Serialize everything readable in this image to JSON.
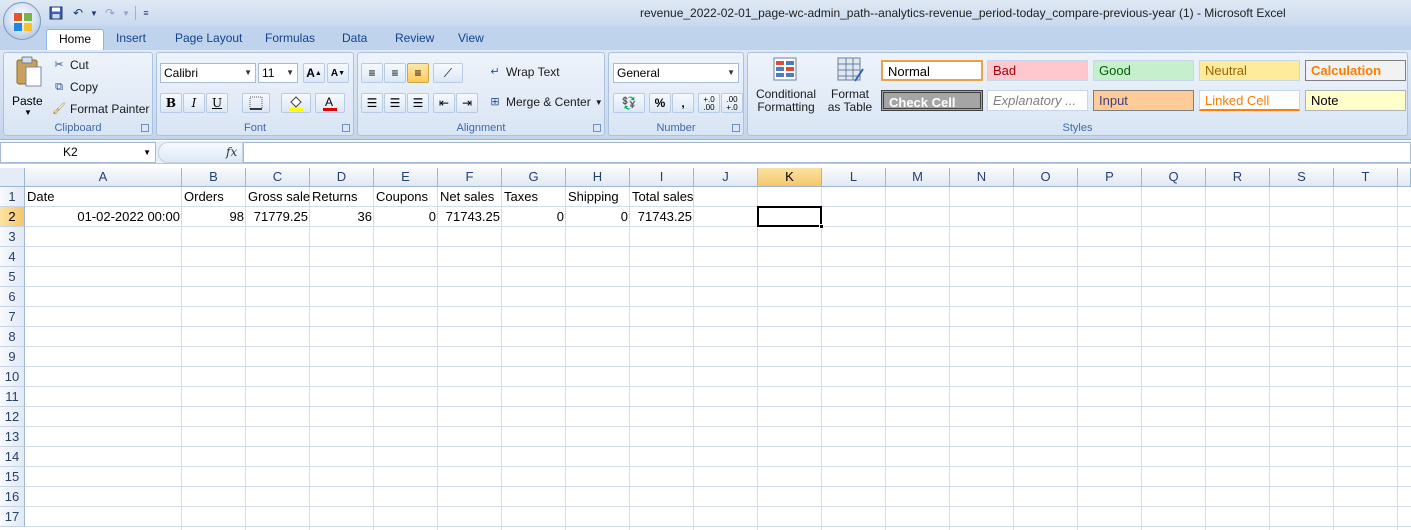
{
  "window": {
    "title": "revenue_2022-02-01_page-wc-admin_path--analytics-revenue_period-today_compare-previous-year (1) - Microsoft Excel"
  },
  "ribbon_tabs": [
    "Home",
    "Insert",
    "Page Layout",
    "Formulas",
    "Data",
    "Review",
    "View"
  ],
  "clipboard": {
    "paste": "Paste",
    "cut": "Cut",
    "copy": "Copy",
    "format_painter": "Format Painter",
    "label": "Clipboard"
  },
  "font": {
    "name": "Calibri",
    "size": "11",
    "bold": "B",
    "italic": "I",
    "underline": "U",
    "grow": "A",
    "shrink": "A",
    "label": "Font"
  },
  "alignment": {
    "wrap_text": "Wrap Text",
    "merge_center": "Merge & Center",
    "label": "Alignment"
  },
  "number": {
    "format": "General",
    "percent": "%",
    "comma": ",",
    "inc_decimal": "+.0 .00",
    "dec_decimal": ".00 +.0",
    "label": "Number"
  },
  "styles": {
    "conditional_formatting": "Conditional Formatting",
    "conditional_line1": "Conditional",
    "conditional_line2": "Formatting",
    "format_table_line1": "Format",
    "format_table_line2": "as Table",
    "label": "Styles",
    "cells": [
      {
        "name": "Normal",
        "bg": "#ffffff",
        "color": "#000000"
      },
      {
        "name": "Bad",
        "bg": "#ffc7ce",
        "color": "#9c0006"
      },
      {
        "name": "Good",
        "bg": "#c6efce",
        "color": "#006100"
      },
      {
        "name": "Neutral",
        "bg": "#ffeb9c",
        "color": "#9c6500"
      },
      {
        "name": "Calculation",
        "bg": "#f2f2f2",
        "color": "#fa7d00"
      },
      {
        "name": "Check Cell",
        "bg": "#a5a5a5",
        "color": "#ffffff"
      },
      {
        "name": "Explanatory ...",
        "bg": "#ffffff",
        "color": "#7f7f7f"
      },
      {
        "name": "Input",
        "bg": "#ffcc99",
        "color": "#3f3f76"
      },
      {
        "name": "Linked Cell",
        "bg": "#ffffff",
        "color": "#fa7d00"
      },
      {
        "name": "Note",
        "bg": "#ffffcc",
        "color": "#000000"
      }
    ]
  },
  "formula_bar": {
    "name_box": "K2",
    "fx": "fx",
    "value": ""
  },
  "grid": {
    "columns": [
      "A",
      "B",
      "C",
      "D",
      "E",
      "F",
      "G",
      "H",
      "I",
      "J",
      "K",
      "L",
      "M",
      "N",
      "O",
      "P",
      "Q",
      "R",
      "S",
      "T"
    ],
    "rows": [
      "1",
      "2",
      "3",
      "4",
      "5",
      "6",
      "7",
      "8",
      "9",
      "10",
      "11",
      "12",
      "13",
      "14",
      "15",
      "16",
      "17"
    ],
    "selected_column": "K",
    "selected_row": "2",
    "header_row": [
      "Date",
      "Orders",
      "Gross sale",
      "Returns",
      "Coupons",
      "Net sales",
      "Taxes",
      "Shipping",
      "Total sales"
    ],
    "data_row": [
      "01-02-2022 00:00",
      "98",
      "71779.25",
      "36",
      "0",
      "71743.25",
      "0",
      "0",
      "71743.25"
    ]
  }
}
